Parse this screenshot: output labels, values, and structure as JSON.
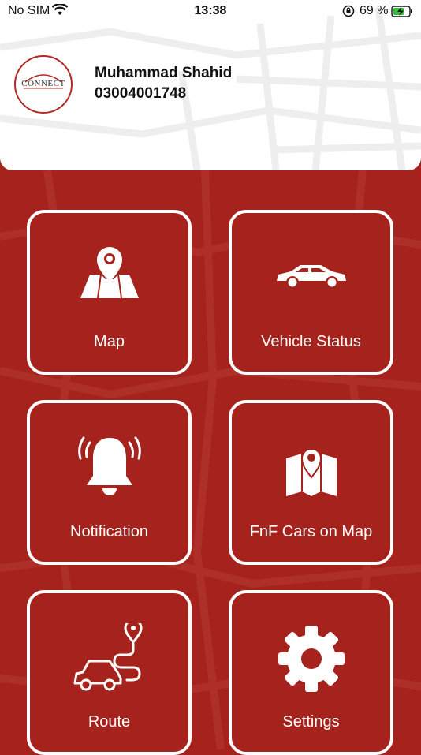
{
  "status_bar": {
    "carrier": "No SIM",
    "time": "13:38",
    "battery_percent": "69 %"
  },
  "profile": {
    "logo_text": "CONNECT",
    "name": "Muhammad Shahid",
    "phone": "03004001748"
  },
  "menu": [
    {
      "label": "Map",
      "icon": "map-pin-icon"
    },
    {
      "label": "Vehicle Status",
      "icon": "car-icon"
    },
    {
      "label": "Notification",
      "icon": "bell-icon"
    },
    {
      "label": "FnF Cars on Map",
      "icon": "folded-map-icon"
    },
    {
      "label": "Route",
      "icon": "route-car-icon"
    },
    {
      "label": "Settings",
      "icon": "gear-icon"
    }
  ],
  "colors": {
    "primary": "#a5231c",
    "tile_border": "#ffffff",
    "header_bg": "#ffffff"
  }
}
